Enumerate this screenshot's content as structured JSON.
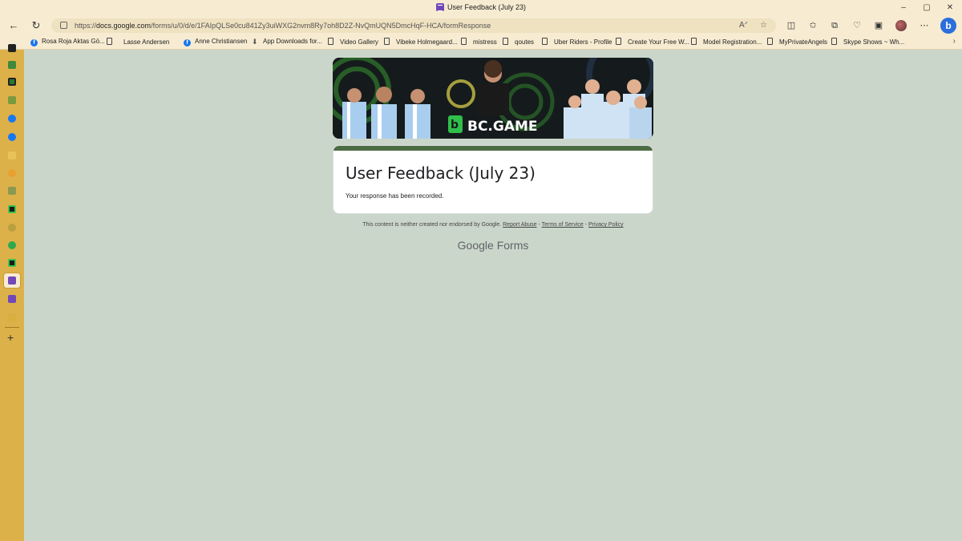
{
  "window": {
    "title": "User Feedback (July 23)",
    "controls": [
      "–",
      "▢",
      "✕"
    ]
  },
  "addressbar": {
    "url_prefix": "https://",
    "url_domain": "docs.google.com",
    "url_path": "/forms/u/0/d/e/1FAIpQLSe0cu841Zy3uiWXG2nvm8Ry7oh8D2Z-NvQmUQN5DmcHqF-HCA/formResponse"
  },
  "bookmarks": [
    {
      "label": "Rosa Roja Aktas Gö...",
      "icon": "facebook-icon"
    },
    {
      "label": "Lasse Andersen",
      "icon": "page-icon"
    },
    {
      "label": "Anne Christiansen",
      "icon": "facebook-icon"
    },
    {
      "label": "App Downloads for...",
      "icon": "download-icon"
    },
    {
      "label": "Video Gallery",
      "icon": "page-icon"
    },
    {
      "label": "Vibeke Holmegaard...",
      "icon": "page-icon"
    },
    {
      "label": "mistress",
      "icon": "page-icon"
    },
    {
      "label": "qoutes",
      "icon": "page-icon"
    },
    {
      "label": "Uber Riders - Profile",
      "icon": "page-icon"
    },
    {
      "label": "Create Your Free W...",
      "icon": "page-icon"
    },
    {
      "label": "Model Registration...",
      "icon": "page-icon"
    },
    {
      "label": "MyPrivateAngels",
      "icon": "page-icon"
    },
    {
      "label": "Skype Shows ~ Wh...",
      "icon": "page-icon"
    }
  ],
  "form": {
    "banner_text": "BC.GAME",
    "title": "User Feedback (July 23)",
    "message": "Your response has been recorded."
  },
  "footer": {
    "disclaimer": "This content is neither created nor endorsed by Google.",
    "report_abuse": "Report Abuse",
    "sep1": " - ",
    "terms": "Terms of Service",
    "sep2": " - ",
    "privacy": "Privacy Policy",
    "brand_google": "Google",
    "brand_forms": "Forms"
  },
  "colors": {
    "page_bg": "#cbd6ca",
    "accent": "#4c6d43",
    "sidebar": "#ddb14a",
    "chrome": "#f7ecd2"
  }
}
